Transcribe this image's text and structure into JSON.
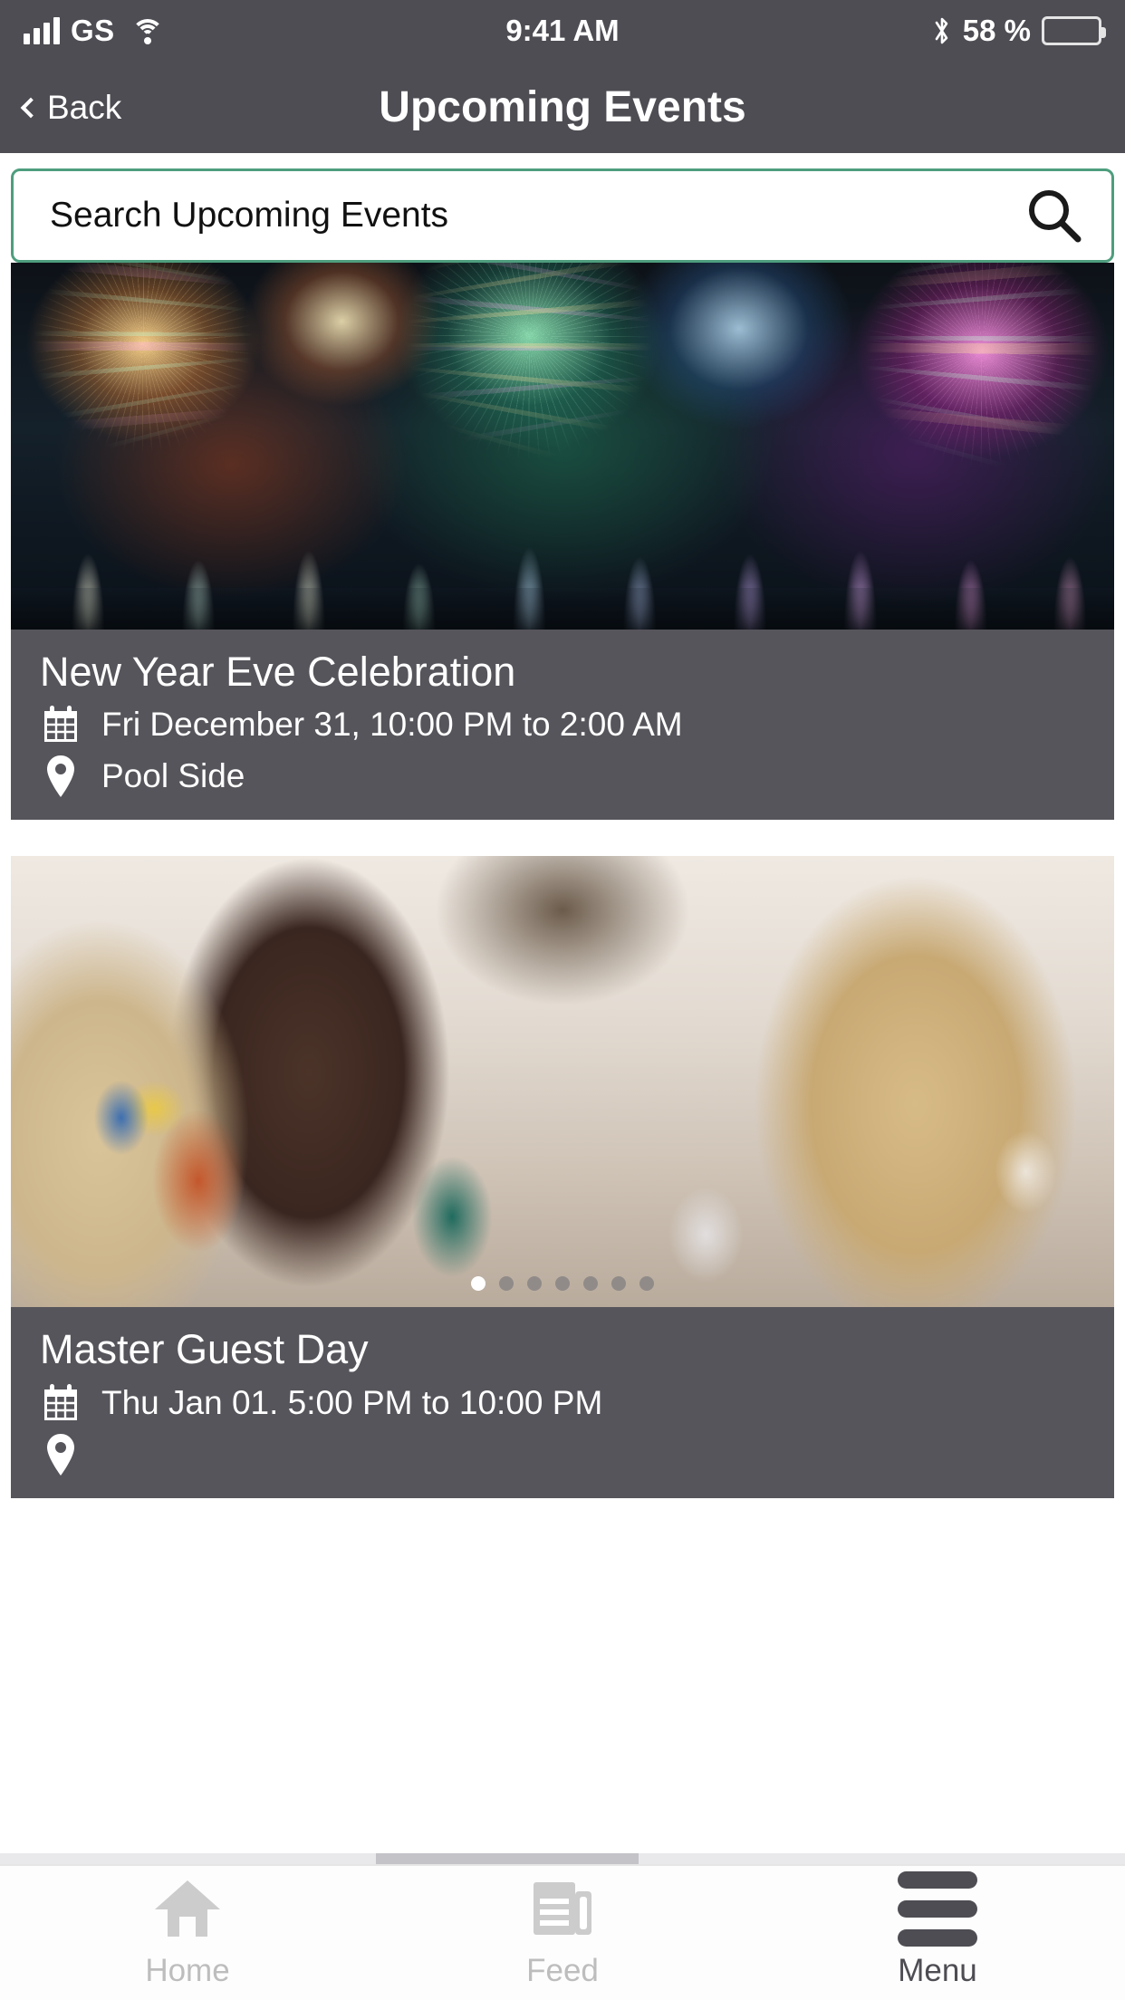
{
  "status_bar": {
    "carrier": "GS",
    "time": "9:41 AM",
    "battery_percent": "58 %",
    "signal_icon": "signal-bars-icon",
    "wifi_icon": "wifi-icon",
    "bluetooth_icon": "bluetooth-icon",
    "battery_icon": "battery-icon"
  },
  "nav": {
    "back_label": "Back",
    "title": "Upcoming Events",
    "back_icon": "chevron-left-icon"
  },
  "search": {
    "placeholder": "Search Upcoming Events",
    "value": "Search Upcoming Events",
    "icon": "search-icon",
    "border_color": "#4e9e7e"
  },
  "events": [
    {
      "title": "New Year Eve Celebration",
      "date": "Fri December 31, 10:00 PM to 2:00 AM",
      "location": "Pool Side",
      "date_icon": "calendar-icon",
      "location_icon": "map-pin-icon",
      "image": "fireworks-over-water-photo",
      "carousel": {
        "count": 0,
        "active": 0
      }
    },
    {
      "title": "Master Guest Day",
      "date": "Thu Jan 01. 5:00 PM to 10:00 PM",
      "location": "",
      "date_icon": "calendar-icon",
      "location_icon": "map-pin-icon",
      "image": "women-with-drinks-photo",
      "carousel": {
        "count": 7,
        "active": 0
      }
    }
  ],
  "tabs": [
    {
      "label": "Home",
      "icon": "home-icon",
      "active": false
    },
    {
      "label": "Feed",
      "icon": "newspaper-icon",
      "active": false
    },
    {
      "label": "Menu",
      "icon": "hamburger-icon",
      "active": true
    }
  ],
  "colors": {
    "chrome": "#4e4d53",
    "card_info": "#56555b",
    "accent": "#4e9e7e",
    "tab_inactive": "#bdbdbd",
    "tab_active": "#4e4d53"
  }
}
